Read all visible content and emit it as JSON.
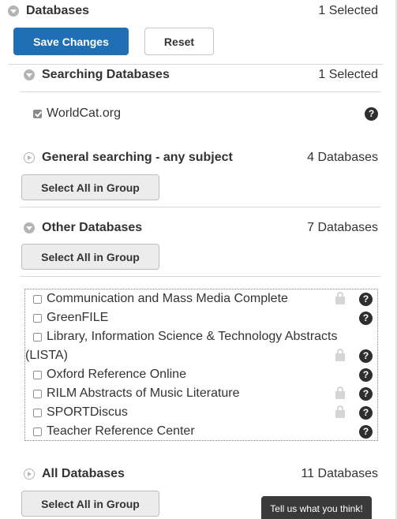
{
  "databases": {
    "title": "Databases",
    "count": "1 Selected"
  },
  "actions": {
    "save_label": "Save Changes",
    "reset_label": "Reset"
  },
  "searching": {
    "title": "Searching Databases",
    "count": "1 Selected",
    "items": [
      {
        "label": "WorldCat.org",
        "checked": true,
        "help": "?"
      }
    ]
  },
  "general": {
    "title": "General searching - any subject",
    "count": "4 Databases",
    "select_all_label": "Select All in Group"
  },
  "other": {
    "title": "Other Databases",
    "count": "7 Databases",
    "select_all_label": "Select All in Group",
    "items": [
      {
        "label": "Communication and Mass Media Complete",
        "locked": true,
        "help": "?"
      },
      {
        "label": "GreenFILE",
        "locked": false,
        "help": "?"
      },
      {
        "label": "Library, Information Science & Technology Abstracts",
        "label_cont": "(LISTA)",
        "locked": true,
        "help": "?"
      },
      {
        "label": "Oxford Reference Online",
        "locked": false,
        "help": "?"
      },
      {
        "label": "RILM Abstracts of Music Literature",
        "locked": true,
        "help": "?"
      },
      {
        "label": "SPORTDiscus",
        "locked": true,
        "help": "?"
      },
      {
        "label": "Teacher Reference Center",
        "locked": false,
        "help": "?"
      }
    ]
  },
  "all": {
    "title": "All Databases",
    "count": "11 Databases",
    "select_all_label": "Select All in Group"
  },
  "feedback": {
    "label": "Tell us what you think!"
  },
  "colors": {
    "primary": "#1f6fb5",
    "feedback_bg": "#3a3a3a"
  },
  "icons": {
    "expanded": "triangle-down-icon",
    "collapsed": "triangle-right-icon",
    "help": "question-circle-icon",
    "lock": "lock-icon"
  }
}
